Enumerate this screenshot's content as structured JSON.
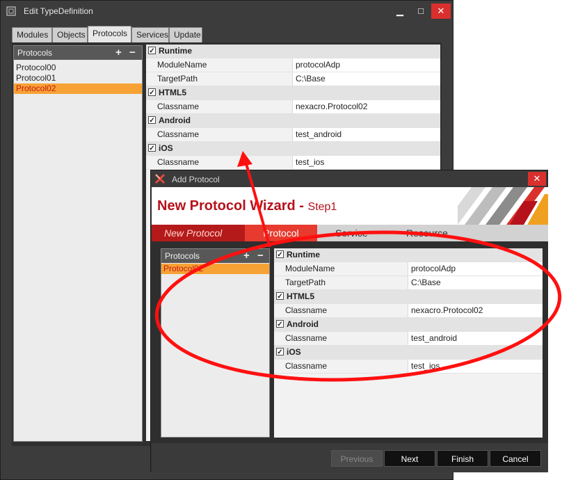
{
  "main_window": {
    "title": "Edit TypeDefinition",
    "controls": {
      "minimize": "▁",
      "maximize": "□",
      "close": "✕"
    },
    "tabs": [
      {
        "label": "Modules",
        "active": false
      },
      {
        "label": "Objects",
        "active": false
      },
      {
        "label": "Protocols",
        "active": true
      },
      {
        "label": "Services",
        "active": false
      },
      {
        "label": "Update",
        "active": false
      }
    ],
    "list": {
      "header": "Protocols",
      "add": "+",
      "remove": "−",
      "items": [
        {
          "label": "Protocol00",
          "selected": false
        },
        {
          "label": "Protocol01",
          "selected": false
        },
        {
          "label": "Protocol02",
          "selected": true
        }
      ]
    },
    "grid": [
      {
        "group": "Runtime",
        "checked": true,
        "rows": [
          {
            "name": "ModuleName",
            "value": "protocolAdp"
          },
          {
            "name": "TargetPath",
            "value": "C:\\Base"
          }
        ]
      },
      {
        "group": "HTML5",
        "checked": true,
        "rows": [
          {
            "name": "Classname",
            "value": "nexacro.Protocol02"
          }
        ]
      },
      {
        "group": "Android",
        "checked": true,
        "rows": [
          {
            "name": "Classname",
            "value": "test_android"
          }
        ]
      },
      {
        "group": "iOS",
        "checked": true,
        "rows": [
          {
            "name": "Classname",
            "value": "test_ios"
          }
        ]
      }
    ]
  },
  "dialog": {
    "title": "Add Protocol",
    "close": "✕",
    "wizard_title": "New Protocol Wizard - ",
    "wizard_step": "Step1",
    "steps": [
      {
        "label": "New Protocol",
        "state": "done"
      },
      {
        "label": "Protocol",
        "state": "current"
      },
      {
        "label": "Service",
        "state": "todo"
      },
      {
        "label": "Resource",
        "state": "todo"
      }
    ],
    "list": {
      "header": "Protocols",
      "add": "+",
      "remove": "−",
      "items": [
        {
          "label": "Protocol02",
          "selected": true
        }
      ]
    },
    "grid": [
      {
        "group": "Runtime",
        "checked": true,
        "rows": [
          {
            "name": "ModuleName",
            "value": "protocolAdp"
          },
          {
            "name": "TargetPath",
            "value": "C:\\Base"
          }
        ]
      },
      {
        "group": "HTML5",
        "checked": true,
        "rows": [
          {
            "name": "Classname",
            "value": "nexacro.Protocol02"
          }
        ]
      },
      {
        "group": "Android",
        "checked": true,
        "rows": [
          {
            "name": "Classname",
            "value": "test_android"
          }
        ]
      },
      {
        "group": "iOS",
        "checked": true,
        "rows": [
          {
            "name": "Classname",
            "value": "test_ios"
          }
        ]
      }
    ],
    "buttons": {
      "previous": "Previous",
      "next": "Next",
      "finish": "Finish",
      "cancel": "Cancel"
    }
  },
  "colors": {
    "accent_red": "#e63b2e",
    "annotation_red": "#ff1010",
    "selection_orange": "#f7a234",
    "window_dark": "#3c3c3c"
  }
}
